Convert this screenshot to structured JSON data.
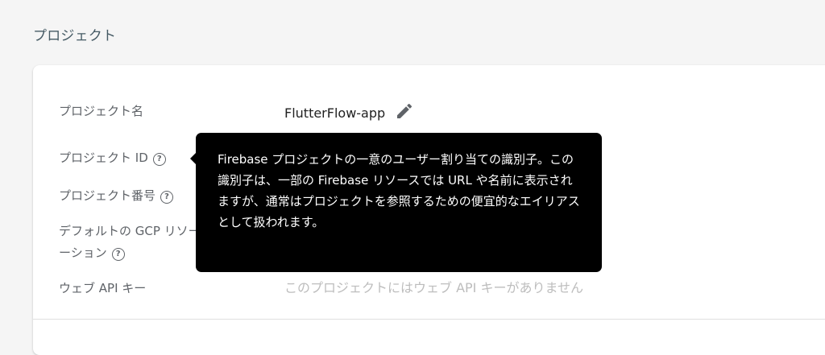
{
  "section": {
    "title": "プロジェクト"
  },
  "rows": {
    "project_name": {
      "label": "プロジェクト名",
      "value": "FlutterFlow-app",
      "edit_icon": "pencil-icon"
    },
    "project_id": {
      "label": "プロジェクト ID",
      "help_icon": "help-circle-icon"
    },
    "project_number": {
      "label": "プロジェクト番号",
      "help_icon": "help-circle-icon"
    },
    "default_gcp_location": {
      "label_line1": "デフォルトの GCP リソース ロケ",
      "label_line2": "ーション",
      "help_icon": "help-circle-icon"
    },
    "web_api_key": {
      "label": "ウェブ API キー",
      "value": "このプロジェクトにはウェブ API キーがありません"
    }
  },
  "tooltip": {
    "text": "Firebase プロジェクトの一意のユーザー割り当ての識別子。この識別子は、一部の Firebase リソースでは URL や名前に表示されますが、通常はプロジェクトを参照するための便宜的なエイリアスとして扱われます。"
  },
  "colors": {
    "page_background": "#f5f5f5",
    "card_background": "#ffffff",
    "label_text": "#5f6368",
    "value_text": "#212121",
    "muted_value_text": "#bdbdbd",
    "tooltip_background": "#000000",
    "tooltip_text": "#ffffff"
  }
}
